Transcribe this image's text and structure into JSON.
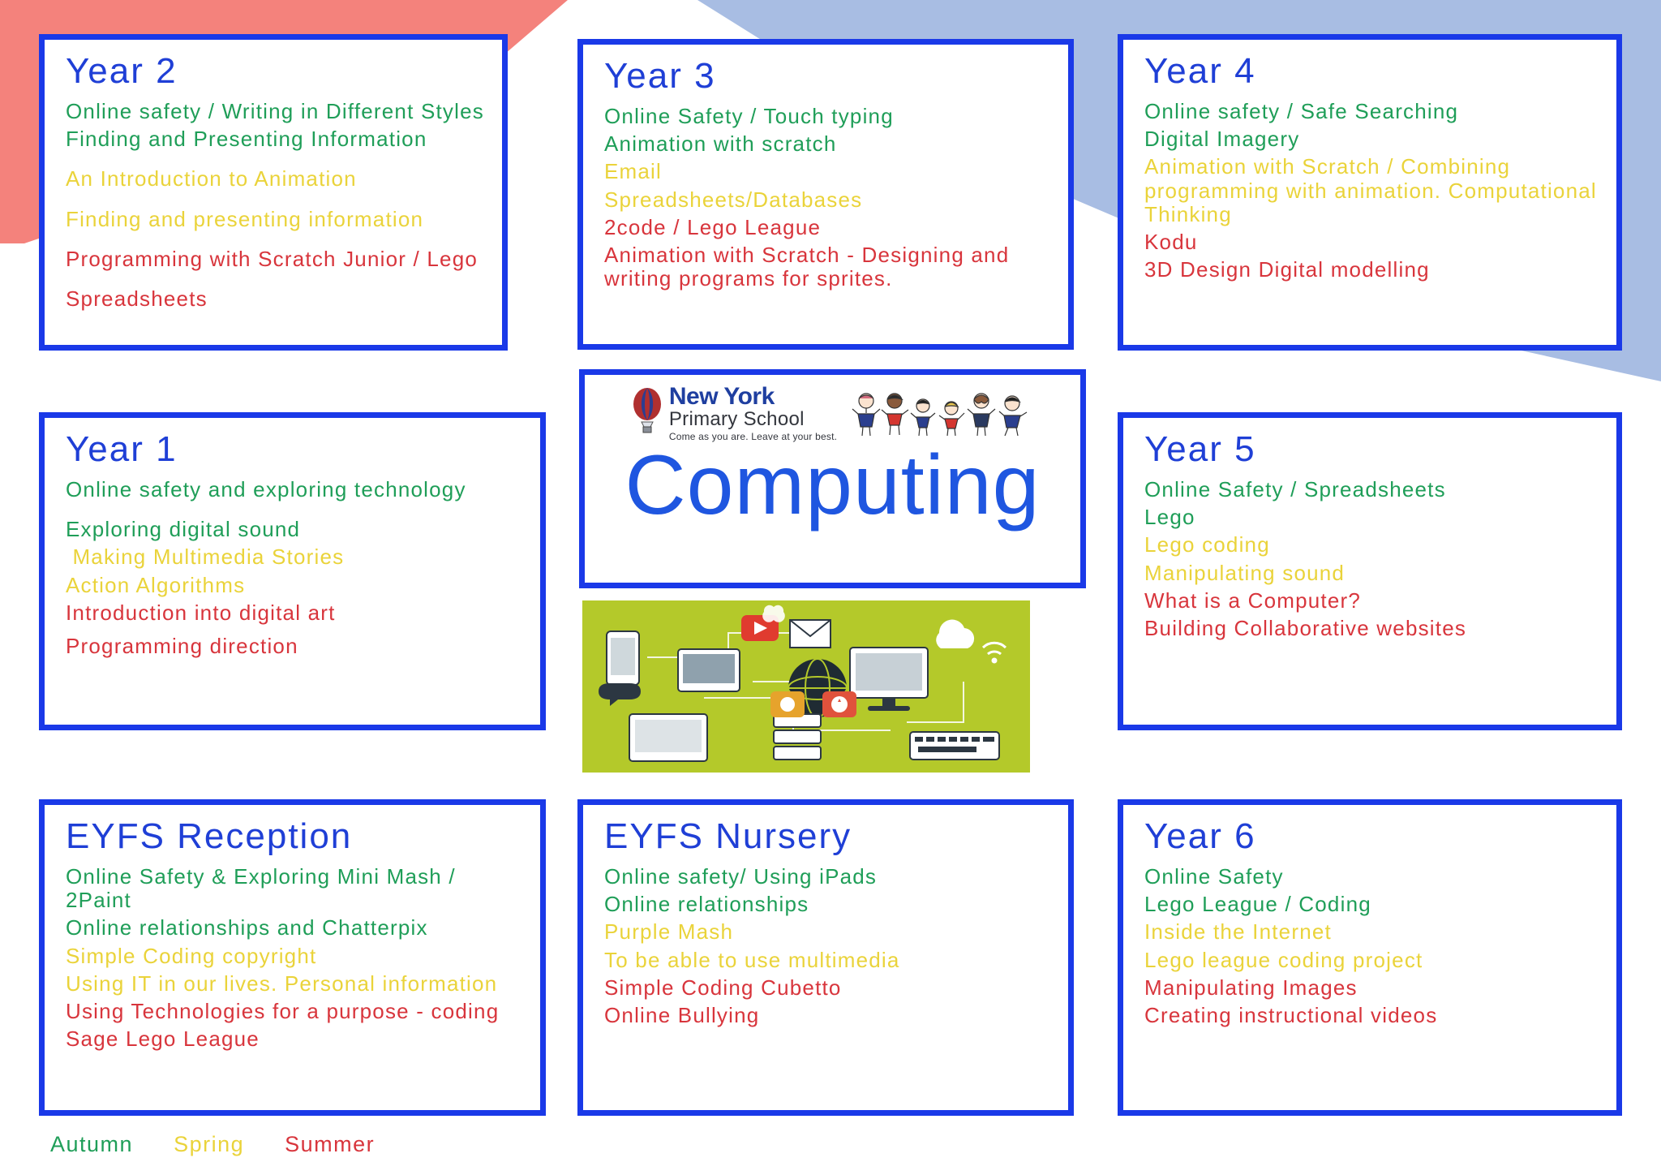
{
  "page": {
    "heading": "Computing",
    "background_colors": {
      "red": "#f4827c",
      "blue": "#a8bde3",
      "border": "#1a39e8"
    }
  },
  "school_logo": {
    "name_line1": "New York",
    "name_line2": "Primary School",
    "tagline": "Come as you are. Leave at your best.",
    "balloon_icon": "hot-air-balloon-icon",
    "children_icon": "children-holding-hands-icon"
  },
  "centre_photo": {
    "alt": "computing-devices-collage-image"
  },
  "key": {
    "autumn": "Autumn",
    "spring": "Spring",
    "summer": "Summer",
    "colors": {
      "autumn": "#1f9e58",
      "spring": "#ead33a",
      "summer": "#d8353c"
    }
  },
  "cards": [
    {
      "id": "year-2",
      "title": "Year 2",
      "topics": [
        {
          "text": "Online safety / Writing in Different Styles",
          "term": "autumn",
          "gap": false
        },
        {
          "text": "Finding and Presenting Information",
          "term": "autumn",
          "gap": false
        },
        {
          "text": "An Introduction to Animation",
          "term": "spring",
          "gap": true
        },
        {
          "text": "Finding and presenting information",
          "term": "spring",
          "gap": true
        },
        {
          "text": "Programming with Scratch Junior / Lego",
          "term": "summer",
          "gap": true
        },
        {
          "text": "Spreadsheets",
          "term": "summer",
          "gap": true
        }
      ]
    },
    {
      "id": "year-3",
      "title": "Year 3",
      "topics": [
        {
          "text": "Online Safety / Touch typing",
          "term": "autumn",
          "gap": false
        },
        {
          "text": "Animation with scratch",
          "term": "autumn",
          "gap": false
        },
        {
          "text": "Email",
          "term": "spring",
          "gap": false
        },
        {
          "text": "Spreadsheets/Databases",
          "term": "spring",
          "gap": false
        },
        {
          "text": "2code / Lego League",
          "term": "summer",
          "gap": false
        },
        {
          "text": "Animation with Scratch - Designing and writing programs for sprites.",
          "term": "summer",
          "gap": false
        }
      ]
    },
    {
      "id": "year-4",
      "title": "Year 4",
      "topics": [
        {
          "text": "Online safety / Safe Searching",
          "term": "autumn",
          "gap": false
        },
        {
          "text": "Digital Imagery",
          "term": "autumn",
          "gap": false
        },
        {
          "text": "Animation with Scratch / Combining programming with animation. Computational Thinking",
          "term": "spring",
          "gap": false
        },
        {
          "text": "Kodu",
          "term": "summer",
          "gap": false
        },
        {
          "text": "3D Design Digital modelling",
          "term": "summer",
          "gap": false
        }
      ]
    },
    {
      "id": "year-1",
      "title": "Year 1",
      "topics": [
        {
          "text": "Online safety and exploring technology",
          "term": "autumn",
          "gap": false
        },
        {
          "text": "Exploring digital sound",
          "term": "autumn",
          "gap": true
        },
        {
          "text": " Making Multimedia Stories",
          "term": "spring",
          "gap": false
        },
        {
          "text": "Action Algorithms",
          "term": "spring",
          "gap": false
        },
        {
          "text": "Introduction into digital art",
          "term": "summer",
          "gap": false
        },
        {
          "text": "Programming direction",
          "term": "summer",
          "gap": true
        }
      ]
    },
    {
      "id": "year-5",
      "title": "Year 5",
      "topics": [
        {
          "text": "Online Safety / Spreadsheets",
          "term": "autumn",
          "gap": false
        },
        {
          "text": "Lego",
          "term": "autumn",
          "gap": false
        },
        {
          "text": "Lego coding",
          "term": "spring",
          "gap": false
        },
        {
          "text": "Manipulating sound",
          "term": "spring",
          "gap": false
        },
        {
          "text": "What is a Computer?",
          "term": "summer",
          "gap": false
        },
        {
          "text": "Building Collaborative websites",
          "term": "summer",
          "gap": false
        }
      ]
    },
    {
      "id": "eyfs-reception",
      "title": "EYFS Reception",
      "topics": [
        {
          "text": "Online Safety & Exploring Mini Mash / 2Paint",
          "term": "autumn",
          "gap": false
        },
        {
          "text": "Online relationships and Chatterpix",
          "term": "autumn",
          "gap": false
        },
        {
          "text": "Simple Coding copyright",
          "term": "spring",
          "gap": false
        },
        {
          "text": "Using IT in our lives. Personal information",
          "term": "spring",
          "gap": false
        },
        {
          "text": "Using Technologies for a purpose - coding",
          "term": "summer",
          "gap": false
        },
        {
          "text": "Sage Lego League",
          "term": "summer",
          "gap": false
        }
      ]
    },
    {
      "id": "eyfs-nursery",
      "title": "EYFS Nursery",
      "topics": [
        {
          "text": "Online safety/ Using iPads",
          "term": "autumn",
          "gap": false
        },
        {
          "text": "Online relationships",
          "term": "autumn",
          "gap": false
        },
        {
          "text": "Purple Mash",
          "term": "spring",
          "gap": false
        },
        {
          "text": "To be able to use multimedia",
          "term": "spring",
          "gap": false
        },
        {
          "text": "Simple Coding Cubetto",
          "term": "summer",
          "gap": false
        },
        {
          "text": "Online Bullying",
          "term": "summer",
          "gap": false
        }
      ]
    },
    {
      "id": "year-6",
      "title": "Year 6",
      "topics": [
        {
          "text": "Online Safety",
          "term": "autumn",
          "gap": false
        },
        {
          "text": "Lego League / Coding",
          "term": "autumn",
          "gap": false
        },
        {
          "text": "Inside the Internet",
          "term": "spring",
          "gap": false
        },
        {
          "text": "Lego league coding project",
          "term": "spring",
          "gap": false
        },
        {
          "text": "Manipulating Images",
          "term": "summer",
          "gap": false
        },
        {
          "text": "Creating instructional videos",
          "term": "summer",
          "gap": false
        }
      ]
    }
  ]
}
